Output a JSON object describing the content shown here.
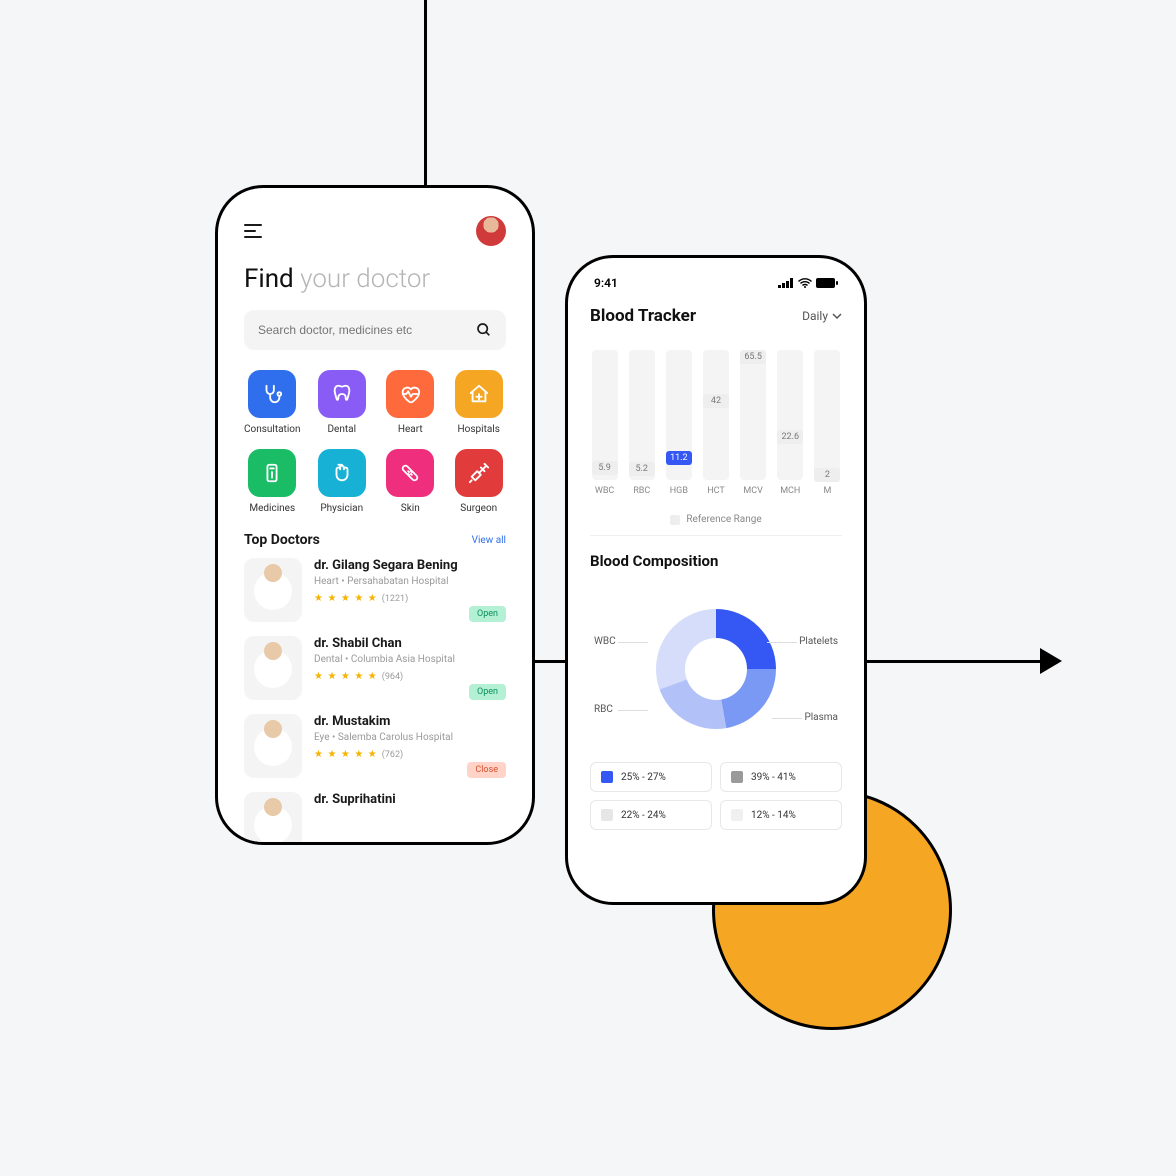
{
  "phone_left": {
    "heading_primary": "Find",
    "heading_secondary": "your doctor",
    "search_placeholder": "Search doctor, medicines etc",
    "categories": [
      {
        "label": "Consultation",
        "color": "#2f6fed",
        "icon": "stethoscope"
      },
      {
        "label": "Dental",
        "color": "#8a5cf6",
        "icon": "tooth"
      },
      {
        "label": "Heart",
        "color": "#ff6a3d",
        "icon": "heart"
      },
      {
        "label": "Hospitals",
        "color": "#f5a623",
        "icon": "hospital"
      },
      {
        "label": "Medicines",
        "color": "#1abc66",
        "icon": "pill"
      },
      {
        "label": "Physician",
        "color": "#17b1d6",
        "icon": "hand"
      },
      {
        "label": "Skin",
        "color": "#ef2e7d",
        "icon": "bandage"
      },
      {
        "label": "Surgeon",
        "color": "#e23b3b",
        "icon": "syringe"
      }
    ],
    "top_doctors_title": "Top Doctors",
    "view_all": "View all",
    "doctors": [
      {
        "name": "dr. Gilang Segara Bening",
        "meta": "Heart  •  Persahabatan Hospital",
        "reviews": "(1221)",
        "status": "Open",
        "open": true
      },
      {
        "name": "dr. Shabil Chan",
        "meta": "Dental  •  Columbia Asia Hospital",
        "reviews": "(964)",
        "status": "Open",
        "open": true
      },
      {
        "name": "dr. Mustakim",
        "meta": "Eye  •  Salemba Carolus Hospital",
        "reviews": "(762)",
        "status": "Close",
        "open": false
      },
      {
        "name": "dr. Suprihatini",
        "meta": "",
        "reviews": "",
        "status": "",
        "open": true
      }
    ]
  },
  "phone_right": {
    "status_time": "9:41",
    "title": "Blood Tracker",
    "period": "Daily",
    "reference_label": "Reference Range",
    "composition_title": "Blood Composition",
    "donut_labels": {
      "wbc": "WBC",
      "rbc": "RBC",
      "platelets": "Platelets",
      "plasma": "Plasma"
    },
    "composition_chips": [
      {
        "range": "25% - 27%",
        "color": "#3557f3"
      },
      {
        "range": "39% - 41%",
        "color": "#9a9a9a"
      },
      {
        "range": "22% - 24%",
        "color": "#e6e6e6"
      },
      {
        "range": "12% - 14%",
        "color": "#f0f0f0"
      }
    ]
  },
  "chart_data": {
    "type": "bar",
    "categories": [
      "WBC",
      "RBC",
      "HGB",
      "HCT",
      "MCV",
      "MCH",
      "M"
    ],
    "values": [
      5.9,
      5.2,
      11.2,
      42.0,
      65.5,
      22.6,
      2
    ],
    "highlighted_index": 2,
    "ylim": [
      0,
      70
    ],
    "title": "Blood Tracker",
    "legend": "Reference Range"
  }
}
